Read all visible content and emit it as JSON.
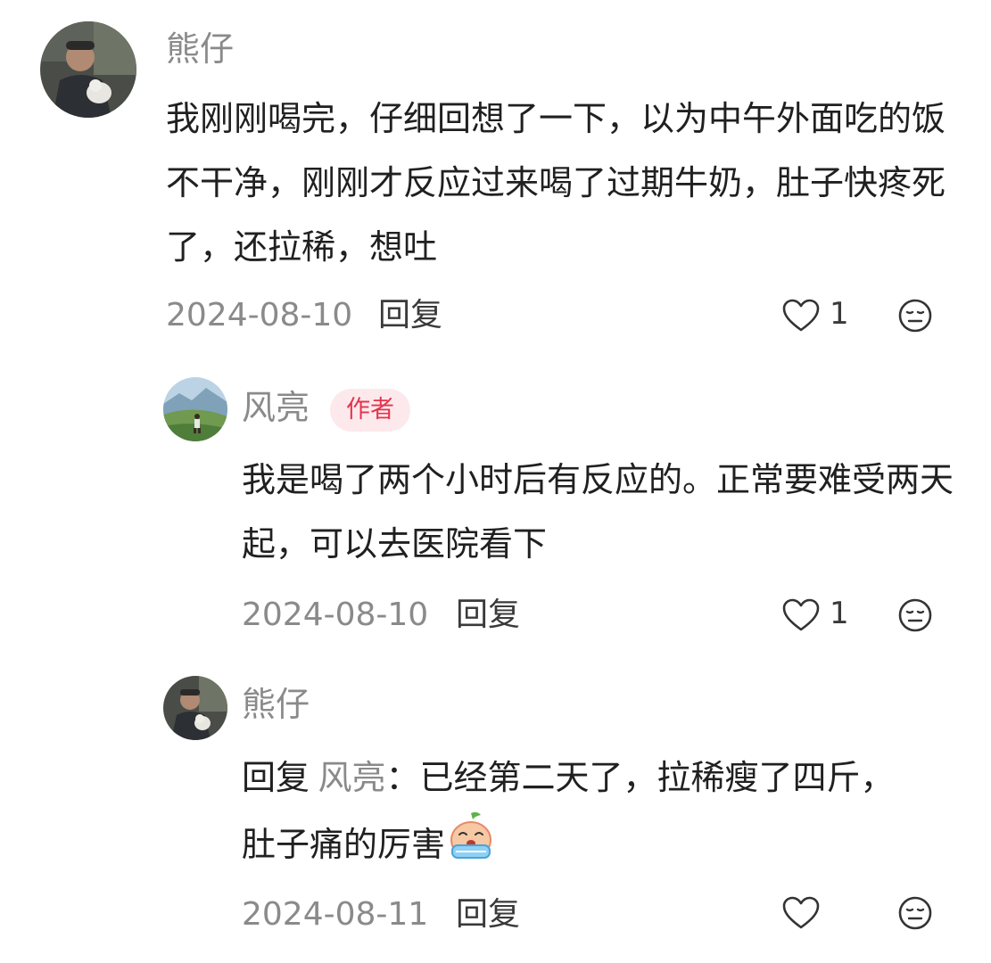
{
  "colors": {
    "background": "#ffffff",
    "name": "#8a8a8a",
    "text": "#202020",
    "date": "#8a8a8a",
    "reply": "#3a3a3a",
    "badge_bg": "#fde9ec",
    "badge_text": "#e5334d"
  },
  "comments": [
    {
      "author": "熊仔",
      "avatar": "avatar-man-with-dog",
      "text": "我刚刚喝完，仔细回想了一下，以为中午外面吃的饭不干净，刚刚才反应过来喝了过期牛奶，肚子快疼死了，还拉稀，想吐",
      "date": "2024-08-10",
      "reply_label": "回复",
      "like_count": "1",
      "like_icon": "heart-icon",
      "dislike_icon": "neutral-face-icon"
    },
    {
      "author": "风亮",
      "badge": "作者",
      "avatar": "avatar-landscape-runner",
      "text": "我是喝了两个小时后有反应的。正常要难受两天起，可以去医院看下",
      "date": "2024-08-10",
      "reply_label": "回复",
      "like_count": "1",
      "like_icon": "heart-icon",
      "dislike_icon": "neutral-face-icon"
    },
    {
      "author": "熊仔",
      "avatar": "avatar-man-with-dog",
      "reply_prefix": "回复",
      "mention": "风亮",
      "text": "：已经第二天了，拉稀瘦了四斤，肚子痛的厉害",
      "emoji": "crying-peach-emoji",
      "date": "2024-08-11",
      "reply_label": "回复",
      "like_count": "",
      "like_icon": "heart-icon",
      "dislike_icon": "neutral-face-icon"
    }
  ]
}
